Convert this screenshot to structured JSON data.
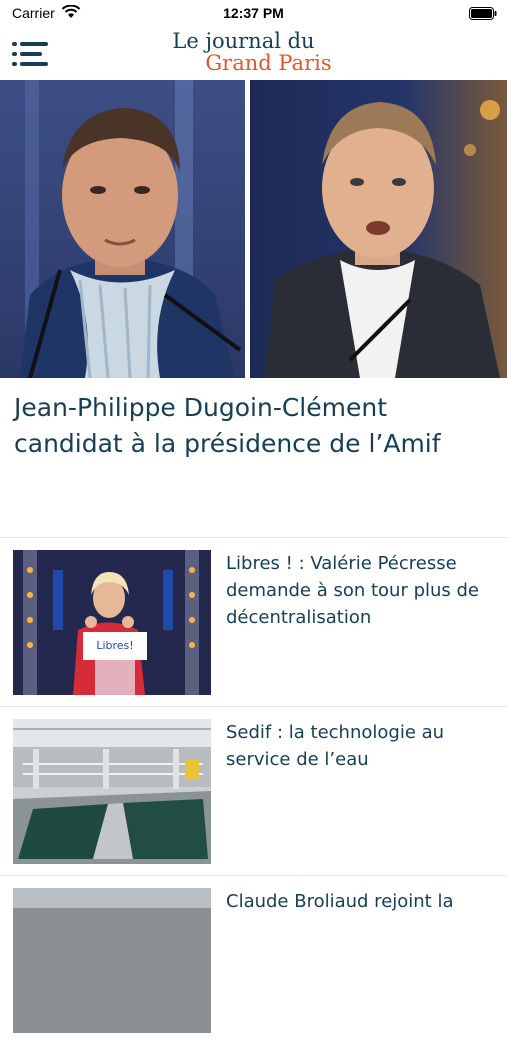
{
  "status_bar": {
    "carrier": "Carrier",
    "time": "12:37 PM"
  },
  "header": {
    "menu_icon": "hamburger-menu-icon",
    "logo_line1": "Le journal du",
    "logo_line2": "Grand Paris",
    "brand_colors": {
      "navy": "#173e52",
      "orange": "#e0572a"
    }
  },
  "hero": {
    "title": "Jean-Philippe Dugoin-Clément candidat à la présidence de l’Amif"
  },
  "articles": [
    {
      "title": "Libres ! : Valérie Pécresse demande à son tour plus de décentralisation",
      "image": "podium-speaker-photo"
    },
    {
      "title": "Sedif : la technologie au service de l’eau",
      "image": "water-treatment-basin-photo"
    },
    {
      "title": "Claude Broliaud rejoint la",
      "image": "article-photo"
    }
  ]
}
